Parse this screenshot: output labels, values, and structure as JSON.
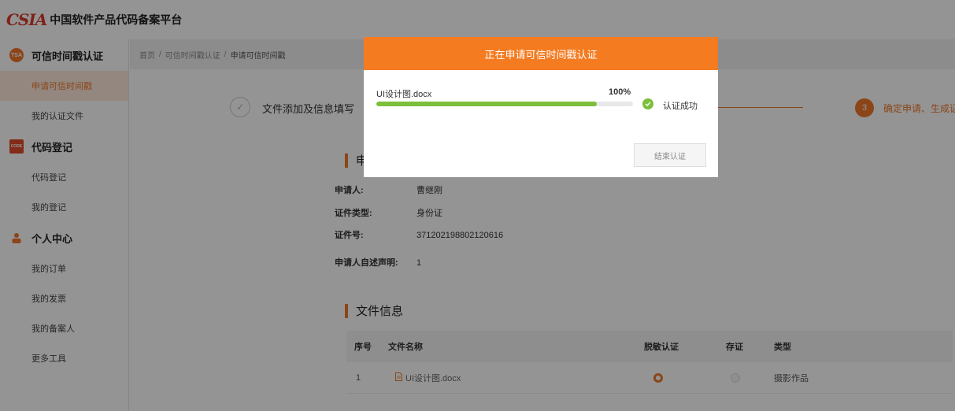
{
  "brand": {
    "logo": "CSIA",
    "title": "中国软件产品代码备案平台"
  },
  "sidebar": {
    "groups": [
      {
        "label": "可信时间戳认证",
        "icon": "tsa-icon",
        "items": [
          "申请可信时间戳",
          "我的认证文件"
        ]
      },
      {
        "label": "代码登记",
        "icon": "code-icon",
        "items": [
          "代码登记",
          "我的登记"
        ]
      },
      {
        "label": "个人中心",
        "icon": "person-icon",
        "items": [
          "我的订单",
          "我的发票",
          "我的备案人",
          "更多工具"
        ]
      }
    ],
    "tsa_icon_text": "TSA",
    "code_icon_text": "CODE"
  },
  "breadcrumb": {
    "home": "首页",
    "sep": "/",
    "level2": "可信时间戳认证",
    "current": "申请可信时间戳"
  },
  "steps": {
    "step1": {
      "mark": "✓",
      "label": "文件添加及信息填写"
    },
    "step3": {
      "number": "3",
      "label": "确定申请、生成证书"
    }
  },
  "applicant_section": {
    "title_fragment": "申"
  },
  "applicant": [
    {
      "label": "申请人:",
      "value": "曹继刚"
    },
    {
      "label": "证件类型:",
      "value": "身份证"
    },
    {
      "label": "证件号:",
      "value": "371202198802120616"
    },
    {
      "label": "申请人自述声明:",
      "value": "1"
    }
  ],
  "file_section": {
    "title": "文件信息"
  },
  "table": {
    "headers": [
      "序号",
      "文件名称",
      "脱敏认证",
      "存证",
      "类型"
    ],
    "rows": [
      {
        "index": "1",
        "file": "UI设计图.docx",
        "desensitize": true,
        "deposit": false,
        "type": "摄影作品"
      }
    ]
  },
  "modal": {
    "title": "正在申请可信时间戳认证",
    "file_name": "UI设计图.docx",
    "progress_label": "100%",
    "progress": 1.0,
    "status_text": "认证成功",
    "button": "结束认证"
  },
  "colors": {
    "accent": "#f47b20",
    "success": "#7bbf3a"
  }
}
